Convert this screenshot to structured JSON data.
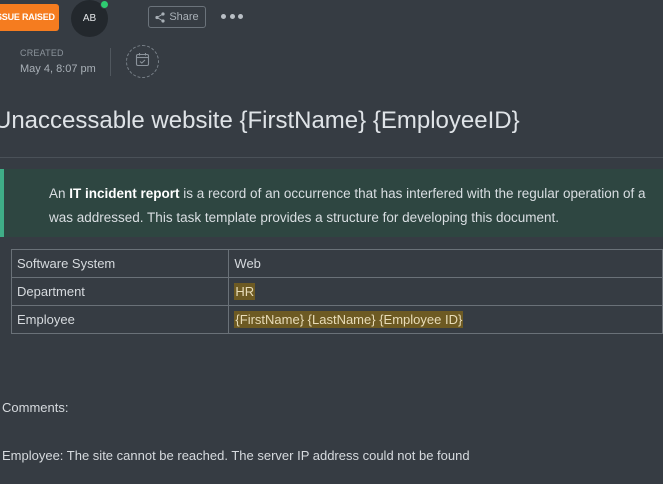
{
  "header": {
    "status_badge": "SSUE RAISED",
    "avatar_initials": "AB",
    "share_label": "Share"
  },
  "meta": {
    "created_label": "CREATED",
    "created_value": "May 4, 8:07 pm"
  },
  "task": {
    "title": "Unaccessable website {FirstName} {EmployeeID}"
  },
  "callout": {
    "prefix": "An ",
    "bold": "IT incident report",
    "line1_rest": " is a record of an occurrence that has interfered with the regular operation of a",
    "line2": "was addressed. This task template provides a structure for developing this document."
  },
  "table": {
    "rows": [
      {
        "key": "Software System",
        "value": "Web"
      },
      {
        "key": "Department",
        "value": "HR"
      },
      {
        "key": "Employee",
        "value": "{FirstName} {LastName} {Employee ID}"
      }
    ]
  },
  "body": {
    "comments_label": "Comments:",
    "employee_comment": "Employee: The site cannot be reached. The server IP address could not be found"
  },
  "colors": {
    "background": "#363c43",
    "status_badge": "#f57c1f",
    "callout_bg": "#2e4641",
    "callout_accent": "#3fae87",
    "highlight": "#6d5a23",
    "presence": "#2ecc71"
  },
  "icons": [
    "share-icon",
    "more-icon",
    "calendar-icon"
  ]
}
